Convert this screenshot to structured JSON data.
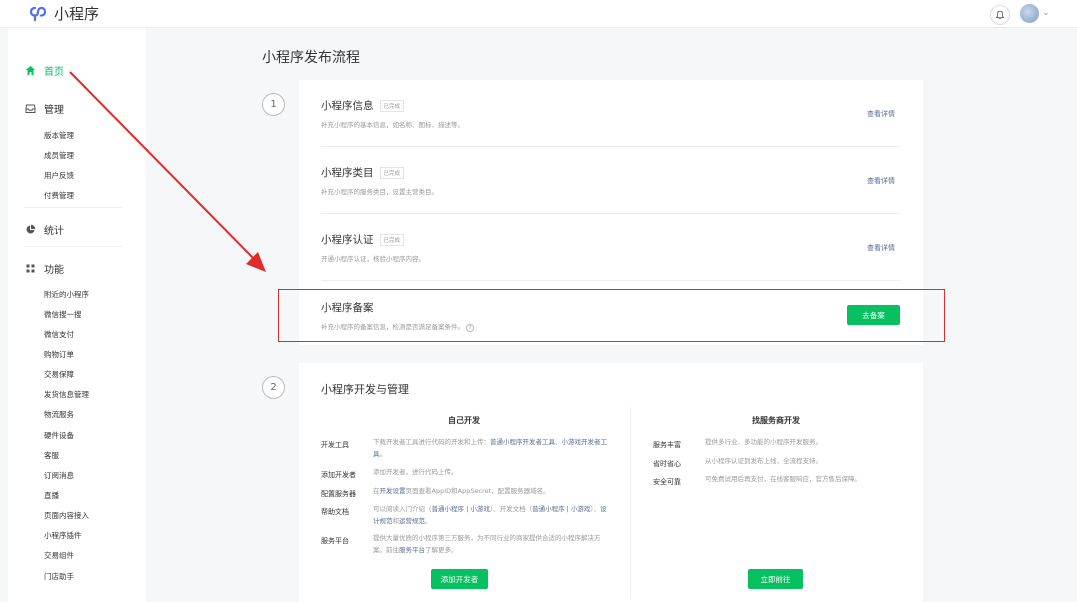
{
  "app": {
    "name": "小程序"
  },
  "sidebar": {
    "home": "首页",
    "manage": "管理",
    "manage_items": [
      "版本管理",
      "成员管理",
      "用户反馈",
      "付费管理"
    ],
    "stats": "统计",
    "features": "功能",
    "feature_items": [
      "附近的小程序",
      "微信搜一搜",
      "微信支付",
      "购物订单",
      "交易保障",
      "发货信息管理",
      "物流服务",
      "硬件设备",
      "客服",
      "订阅消息",
      "直播",
      "页面内容接入",
      "小程序插件",
      "交易组件",
      "门店助手"
    ]
  },
  "main": {
    "title": "小程序发布流程",
    "step1": "1",
    "step2": "2",
    "publish_items": [
      {
        "title": "小程序信息",
        "tag": "已完成",
        "desc": "补充小程序的基本信息，如名称、图标、描述等。",
        "link": "查看详情"
      },
      {
        "title": "小程序类目",
        "tag": "已完成",
        "desc": "补充小程序的服务类目，设置主营类目。",
        "link": "查看详情"
      },
      {
        "title": "小程序认证",
        "tag": "已完成",
        "desc": "开通小程序认证，核验小程序内容。",
        "link": "查看详情"
      }
    ],
    "filing": {
      "title": "小程序备案",
      "desc": "补充小程序的备案信息，检测是否满足备案条件。",
      "help_icon": "?",
      "button": "去备案"
    },
    "dev": {
      "title": "小程序开发与管理",
      "self": {
        "heading": "自己开发",
        "rows": [
          {
            "label": "开发工具",
            "text": "下载开发者工具进行代码的开发和上传：",
            "link1": "普通小程序开发者工具",
            "sep": "、",
            "link2": "小游戏开发者工具",
            "end": "。"
          },
          {
            "label": "添加开发者",
            "text": "添加开发者，进行代码上传。"
          },
          {
            "label": "配置服务器",
            "pre": "在",
            "link1": "开发设置",
            "text": "页面查看AppID和AppSecret，配置服务器域名。"
          },
          {
            "label": "帮助文档",
            "t1": "可以阅读入门介绍（",
            "l1": "普通小程序",
            "s1": " | ",
            "l2": "小游戏",
            "t2": "）、开发文档（",
            "l3": "普通小程序",
            "s2": " | ",
            "l4": "小游戏",
            "t3": "）、",
            "l5": "设计规范",
            "t4": "和",
            "l6": "运营规范",
            "t5": "。"
          },
          {
            "label": "服务平台",
            "text": "提供大量优质的小程序第三方服务，为不同行业的商家提供合适的小程序解决方案。前往",
            "link1": "服务平台",
            "end": "了解更多。"
          }
        ],
        "button": "添加开发者"
      },
      "vendor": {
        "heading": "找服务商开发",
        "rows": [
          {
            "label": "服务丰富",
            "text": "提供多行业、多功能的小程序开发服务。"
          },
          {
            "label": "省时省心",
            "text": "从小程序认证到发布上线，全流程支持。"
          },
          {
            "label": "安全可靠",
            "text": "可免费试用后再支付，在线客服响应，官方售后保障。"
          }
        ],
        "button": "立即前往"
      }
    }
  },
  "colors": {
    "accent": "#07c160",
    "link": "#576b95",
    "highlight": "#e12b2b"
  },
  "icons": [
    "logo-icon",
    "bell-icon",
    "home-icon",
    "inbox-icon",
    "pie-chart-icon",
    "grid-icon",
    "help-icon"
  ]
}
